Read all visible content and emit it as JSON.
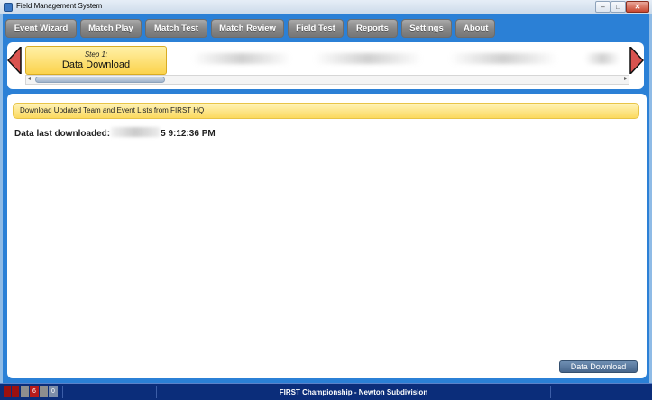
{
  "window": {
    "title": "Field Management System",
    "controls": {
      "minimize": "–",
      "maximize": "□",
      "close": "✕"
    }
  },
  "nav": {
    "tabs": [
      "Event Wizard",
      "Match Play",
      "Match Test",
      "Match Review",
      "Field Test",
      "Reports",
      "Settings",
      "About"
    ]
  },
  "wizard": {
    "step_number": "Step 1:",
    "step_name": "Data Download",
    "arrow_color": "#d9534f"
  },
  "content": {
    "banner": "Download Updated Team and Event Lists from FIRST HQ",
    "last_downloaded_label": "Data last downloaded:",
    "last_downloaded_suffix": "5 9:12:36 PM",
    "download_button": "Data Download"
  },
  "status": {
    "counter_a": "6",
    "counter_b": "0",
    "event_name": "FIRST Championship - Newton Subdivision"
  }
}
